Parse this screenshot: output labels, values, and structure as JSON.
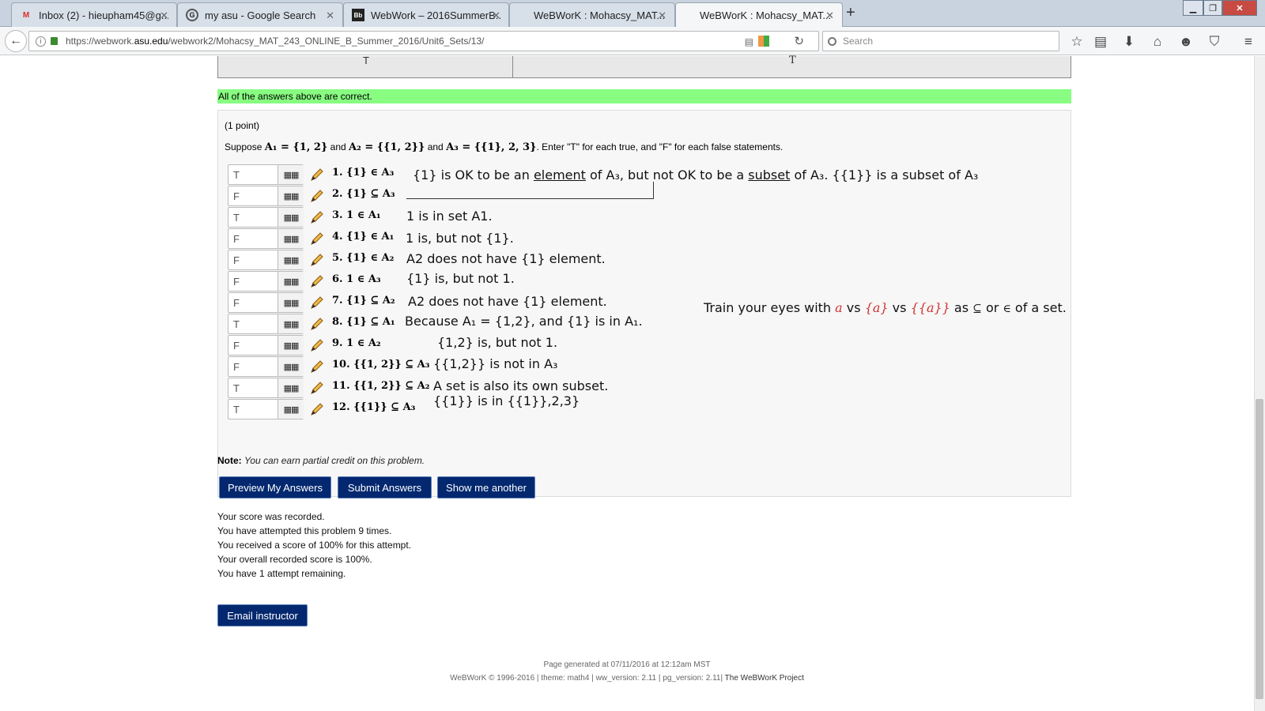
{
  "tabs": [
    {
      "label": "Inbox (2) - hieupham45@g...",
      "icon": "gmail-icon",
      "active": false
    },
    {
      "label": "my asu - Google Search",
      "icon": "google-icon",
      "active": false
    },
    {
      "label": "WebWork – 2016SummerB...",
      "icon": "blackboard-icon",
      "active": false
    },
    {
      "label": "WeBWorK : Mohacsy_MAT...",
      "icon": "",
      "active": false
    },
    {
      "label": "WeBWorK : Mohacsy_MAT...",
      "icon": "",
      "active": true
    }
  ],
  "address": {
    "url_prefix": "https://webwork.",
    "url_domain": "asu.edu",
    "url_path": "/webwork2/Mohacsy_MAT_243_ONLINE_B_Summer_2016/Unit6_Sets/13/",
    "search_placeholder": "Search"
  },
  "prev_table": {
    "cell1": "T",
    "cell2": "T"
  },
  "correct_banner": "All of the answers above are correct.",
  "problem": {
    "points": "(1 point)",
    "statement_intro": "Suppose",
    "a1": "A₁ = {1, 2}",
    "and1": "and",
    "a2": "A₂ = {{1, 2}}",
    "and2": "and",
    "a3": "A₃ = {{1}, 2, 3}",
    "statement_end": ". Enter \"T\" for each true, and \"F\" for each false statements.",
    "questions": [
      {
        "answer": "T",
        "label": "1. {1} ∈ A₃"
      },
      {
        "answer": "F",
        "label": "2. {1} ⊆ A₃"
      },
      {
        "answer": "T",
        "label": "3. 1 ∈ A₁"
      },
      {
        "answer": "F",
        "label": "4. {1} ∈ A₁"
      },
      {
        "answer": "F",
        "label": "5. {1} ∈ A₂"
      },
      {
        "answer": "F",
        "label": "6. 1 ∈ A₃"
      },
      {
        "answer": "F",
        "label": "7. {1} ⊆ A₂"
      },
      {
        "answer": "T",
        "label": "8. {1} ⊆ A₁"
      },
      {
        "answer": "F",
        "label": "9. 1 ∈ A₂"
      },
      {
        "answer": "F",
        "label": "10. {{1, 2}} ⊆ A₃"
      },
      {
        "answer": "T",
        "label": "11. {{1, 2}} ⊆ A₂"
      },
      {
        "answer": "T",
        "label": "12. {{1}} ⊆ A₃"
      }
    ]
  },
  "annotations": {
    "n1_a": "{1} is OK to be an ",
    "n1_b": "element",
    "n1_c": " of A₃, but not OK to be a ",
    "n1_d": "subset",
    "n1_e": " of A₃. {{1}} is a subset of A₃",
    "n3": "1 is in set A1.",
    "n4": "1 is, but not {1}.",
    "n5": "A2 does not have {1} element.",
    "n6": "{1} is, but not 1.",
    "n7": "A2 does not have {1} element.",
    "n8": "Because A₁ = {1,2}, and {1} is in A₁.",
    "n9": "{1,2} is, but not 1.",
    "n10": "{{1,2}} is not in A₃",
    "n11": "A set is also its own subset.",
    "n12": "{{1}} is in {{1}},2,3}",
    "train_a": "Train your eyes with ",
    "train_b": "a",
    "train_c": " vs ",
    "train_d": "{a}",
    "train_e": " vs ",
    "train_f": "{{a}}",
    "train_g": " as ",
    "train_h": "⊆",
    "train_i": " or ",
    "train_j": "∈",
    "train_k": " of a set."
  },
  "note_label": "Note:",
  "note_text": "You can earn partial credit on this problem.",
  "buttons": {
    "preview": "Preview My Answers",
    "submit": "Submit Answers",
    "another": "Show me another",
    "email": "Email instructor"
  },
  "status": [
    "Your score was recorded.",
    "You have attempted this problem 9 times.",
    "You received a score of 100% for this attempt.",
    "Your overall recorded score is 100%.",
    "You have 1 attempt remaining."
  ],
  "footer": {
    "generated": "Page generated at 07/11/2016 at 12:12am MST",
    "credits": "WeBWorK © 1996-2016 | theme: math4 | ww_version: 2.11 | pg_version: 2.11|",
    "project": "The WeBWorK Project"
  },
  "colors": {
    "accent_button": "#03286f",
    "correct_banner": "#88fd82",
    "annotation_red": "#d23030"
  }
}
